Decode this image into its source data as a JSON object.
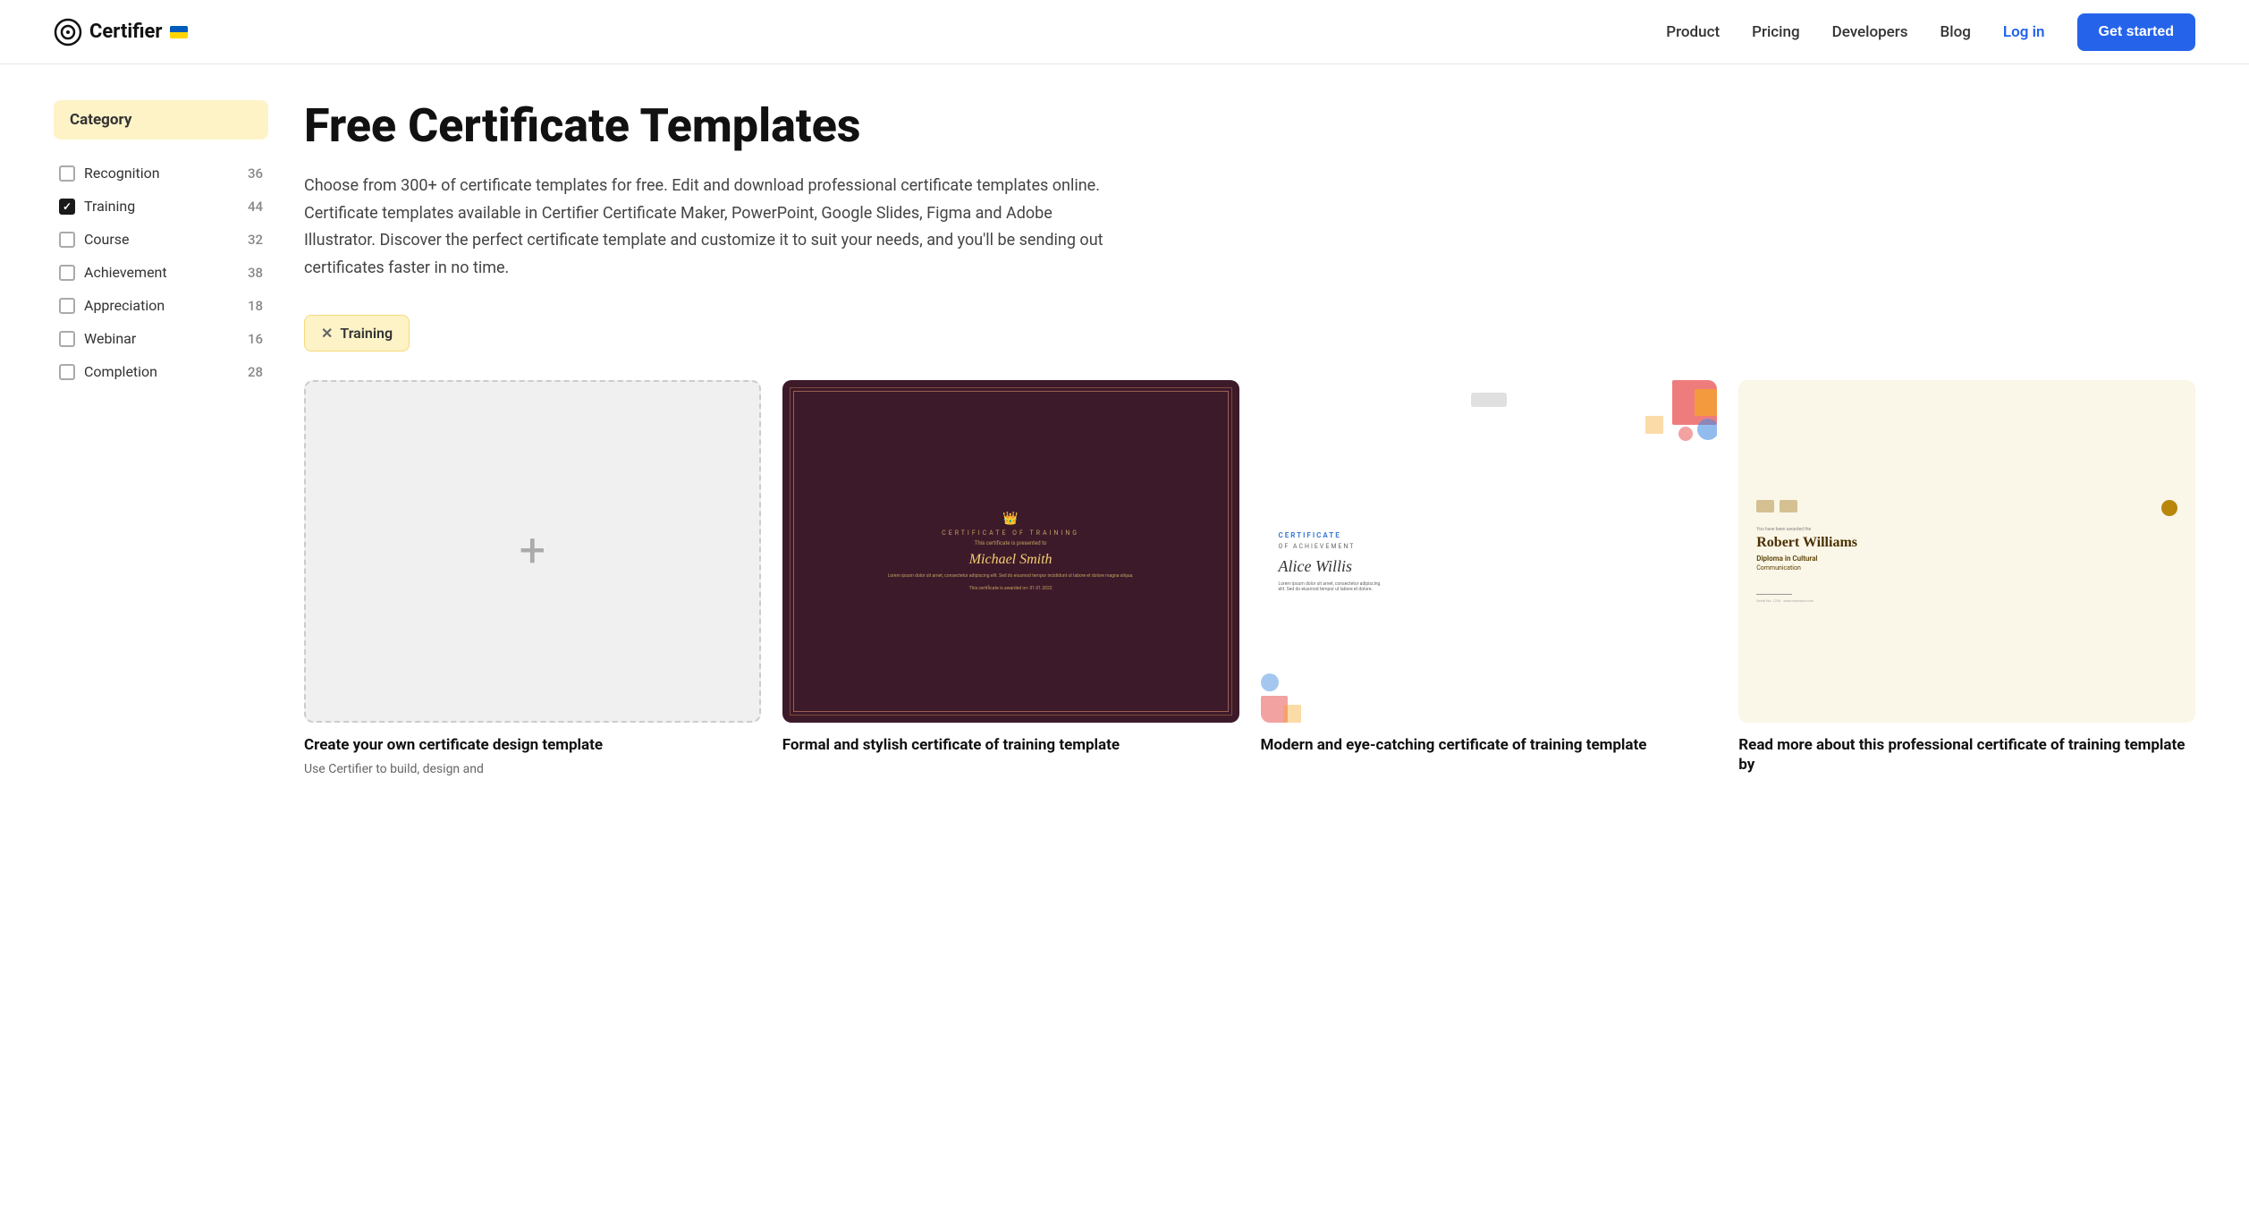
{
  "nav": {
    "logo_text": "Certifier",
    "links": [
      {
        "label": "Product",
        "href": "#"
      },
      {
        "label": "Pricing",
        "href": "#"
      },
      {
        "label": "Developers",
        "href": "#"
      },
      {
        "label": "Blog",
        "href": "#"
      }
    ],
    "login_label": "Log in",
    "cta_label": "Get started"
  },
  "sidebar": {
    "header": "Category",
    "items": [
      {
        "name": "Recognition",
        "count": 36,
        "checked": false
      },
      {
        "name": "Training",
        "count": 44,
        "checked": true
      },
      {
        "name": "Course",
        "count": 32,
        "checked": false
      },
      {
        "name": "Achievement",
        "count": 38,
        "checked": false
      },
      {
        "name": "Appreciation",
        "count": 18,
        "checked": false
      },
      {
        "name": "Webinar",
        "count": 16,
        "checked": false
      },
      {
        "name": "Completion",
        "count": 28,
        "checked": false
      }
    ]
  },
  "main": {
    "title": "Free Certificate Templates",
    "description": "Choose from 300+ of certificate templates for free. Edit and download professional certificate templates online. Certificate templates available in Certifier Certificate Maker, PowerPoint, Google Slides, Figma and Adobe Illustrator. Discover the perfect certificate template and customize it to suit your needs, and you'll be sending out certificates faster in no time.",
    "active_filter": "Training",
    "cards": [
      {
        "id": "create-own",
        "type": "create",
        "title": "Create your own certificate design template",
        "subtitle": "Use Certifier to build, design and"
      },
      {
        "id": "formal-stylish",
        "type": "maroon",
        "title": "Formal and stylish certificate of training template",
        "subtitle": "",
        "cert_name": "Michael Smith"
      },
      {
        "id": "modern-eyecatching",
        "type": "colorful",
        "title": "Modern and eye-catching certificate of training template",
        "subtitle": "",
        "cert_name": "Alice Willis"
      },
      {
        "id": "robert-williams",
        "type": "rwilliams",
        "title": "Read more about this professional certificate of training template by",
        "subtitle": "",
        "cert_name": "Robert Williams",
        "cert_degree": "Diploma in Cultural Communication"
      }
    ]
  }
}
